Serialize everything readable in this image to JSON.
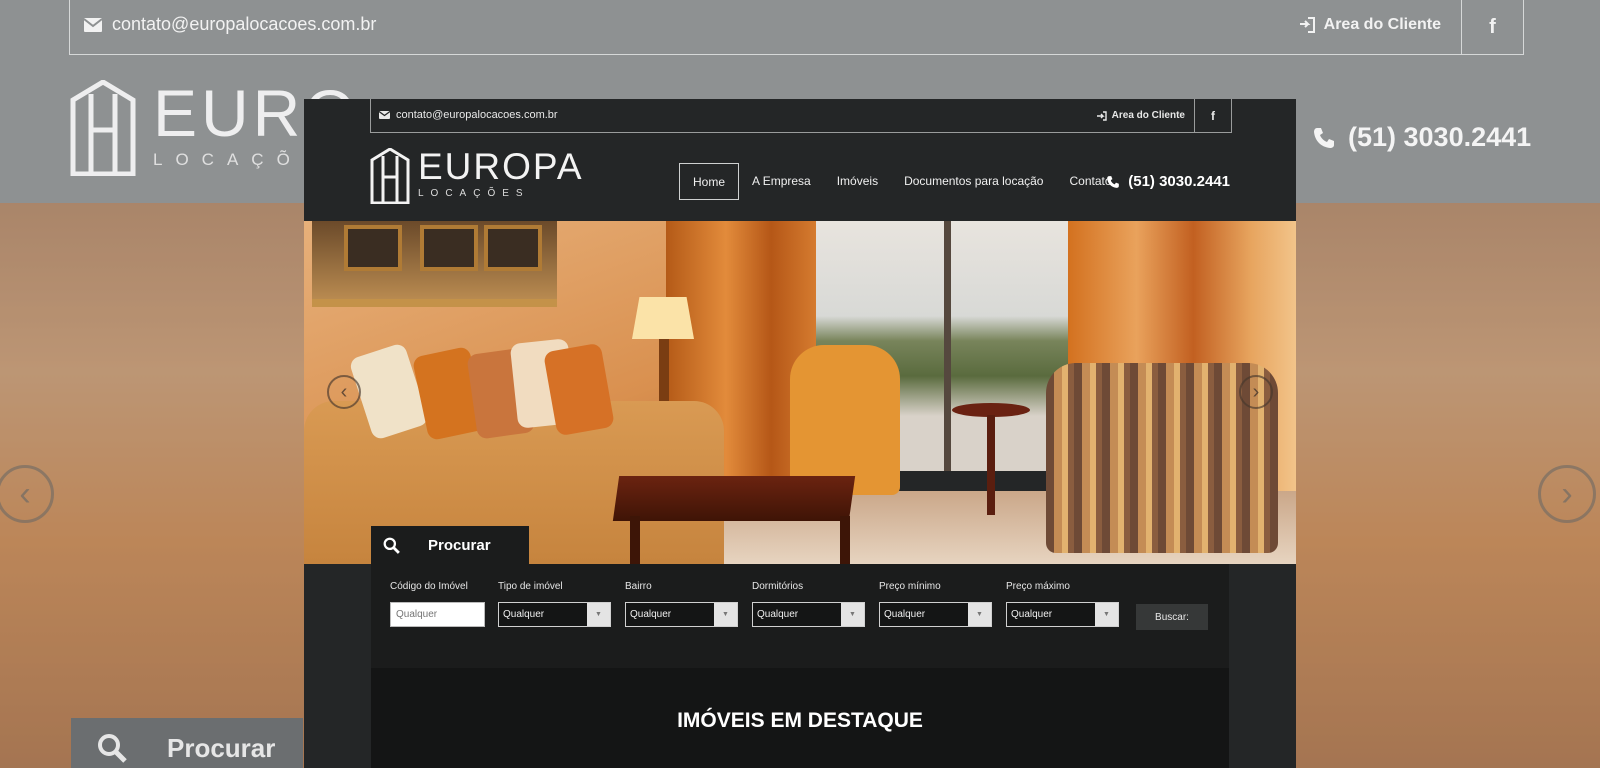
{
  "header": {
    "email": "contato@europalocacoes.com.br",
    "client_area": "Area do Cliente",
    "facebook": "f",
    "logo_title": "EUROPA",
    "logo_subtitle": "LOCAÇÕES",
    "phone": "(51) 3030.2441"
  },
  "background_header": {
    "email": "contato@europalocacoes.com.br",
    "client_area": "Area do Cliente",
    "facebook": "f",
    "logo_title": "EURO",
    "logo_subtitle": "LOCAÇÕE",
    "phone": "(51) 3030.2441",
    "search_tab": "Procurar"
  },
  "nav": {
    "items": [
      "Home",
      "A Empresa",
      "Imóveis",
      "Documentos para locação",
      "Contato"
    ],
    "active": "Home"
  },
  "slider": {
    "prev_icon": "chevron-left-icon",
    "next_icon": "chevron-right-icon"
  },
  "search": {
    "tab_label": "Procurar",
    "fields": [
      {
        "label": "Código do Imóvel",
        "type": "text",
        "placeholder": "Qualquer"
      },
      {
        "label": "Tipo de imóvel",
        "type": "select",
        "value": "Qualquer"
      },
      {
        "label": "Bairro",
        "type": "select",
        "value": "Qualquer"
      },
      {
        "label": "Dormitórios",
        "type": "select",
        "value": "Qualquer"
      },
      {
        "label": "Preço mínimo",
        "type": "select",
        "value": "Qualquer"
      },
      {
        "label": "Preço máximo",
        "type": "select",
        "value": "Qualquer"
      }
    ],
    "submit_label": "Buscar:"
  },
  "featured": {
    "title": "IMÓVEIS EM DESTAQUE"
  },
  "colors": {
    "header_bg": "#242627",
    "panel_bg": "#1b1c1c",
    "outer_bg": "#8e9192"
  }
}
